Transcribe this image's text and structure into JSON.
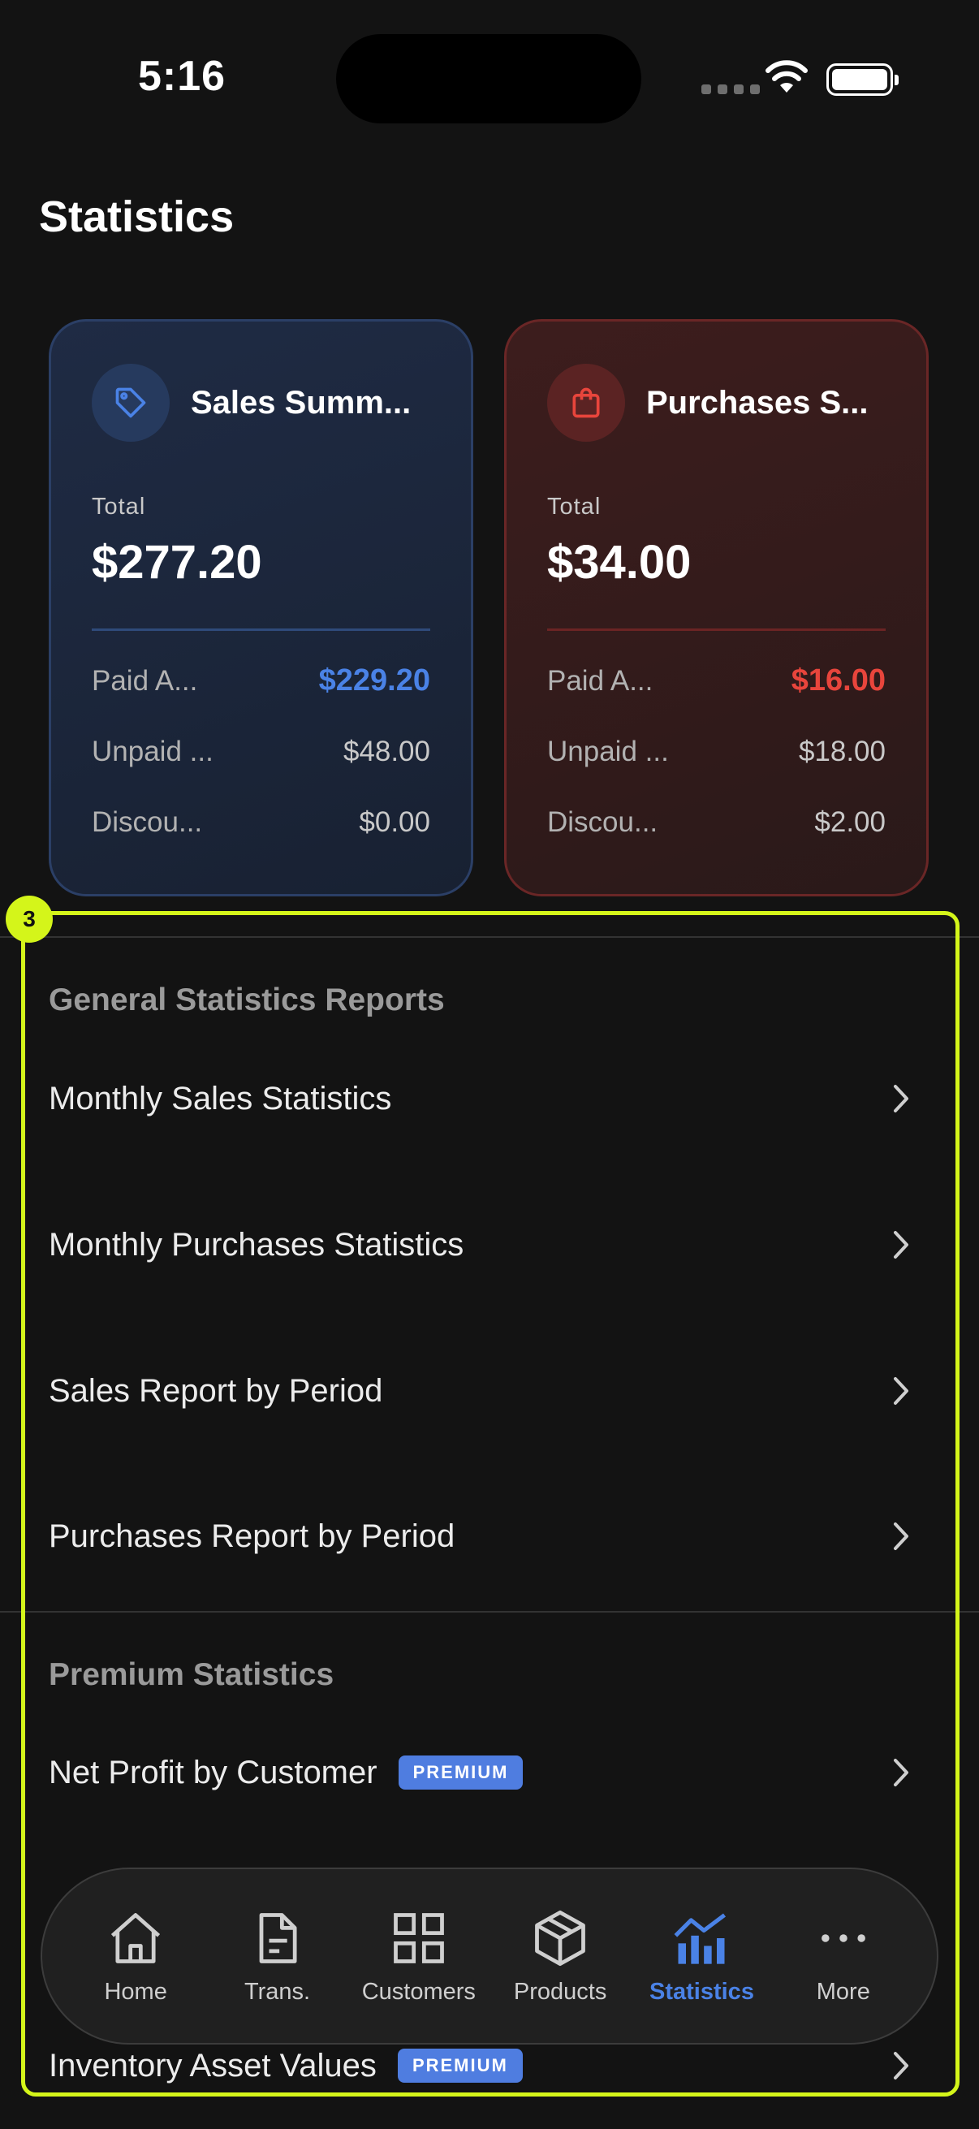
{
  "status_bar": {
    "time": "5:16"
  },
  "page": {
    "title": "Statistics"
  },
  "cards": {
    "sales": {
      "title": "Sales Summ...",
      "total_label": "Total",
      "total": "$277.20",
      "rows": [
        {
          "label": "Paid A...",
          "value": "$229.20"
        },
        {
          "label": "Unpaid ...",
          "value": "$48.00"
        },
        {
          "label": "Discou...",
          "value": "$0.00"
        }
      ]
    },
    "purchases": {
      "title": "Purchases S...",
      "total_label": "Total",
      "total": "$34.00",
      "rows": [
        {
          "label": "Paid A...",
          "value": "$16.00"
        },
        {
          "label": "Unpaid ...",
          "value": "$18.00"
        },
        {
          "label": "Discou...",
          "value": "$2.00"
        }
      ]
    }
  },
  "reports": {
    "general_header": "General Statistics Reports",
    "general_items": [
      {
        "label": "Monthly Sales Statistics"
      },
      {
        "label": "Monthly Purchases Statistics"
      },
      {
        "label": "Sales Report by Period"
      },
      {
        "label": "Purchases Report by Period"
      }
    ],
    "premium_header": "Premium Statistics",
    "premium_items": [
      {
        "label": "Net Profit by Customer",
        "badge": "PREMIUM"
      },
      {
        "label": "Inventory Asset Values",
        "badge": "PREMIUM"
      }
    ]
  },
  "highlight": {
    "number": "3"
  },
  "tabbar": {
    "tabs": [
      {
        "label": "Home",
        "icon": "home-icon"
      },
      {
        "label": "Trans.",
        "icon": "document-icon"
      },
      {
        "label": "Customers",
        "icon": "grid-icon"
      },
      {
        "label": "Products",
        "icon": "box-icon"
      },
      {
        "label": "Statistics",
        "icon": "chart-icon",
        "active": true
      },
      {
        "label": "More",
        "icon": "more-icon"
      }
    ]
  },
  "colors": {
    "accent_blue": "#4a82e6",
    "accent_red": "#e8453c",
    "highlight": "#d4f51a"
  }
}
